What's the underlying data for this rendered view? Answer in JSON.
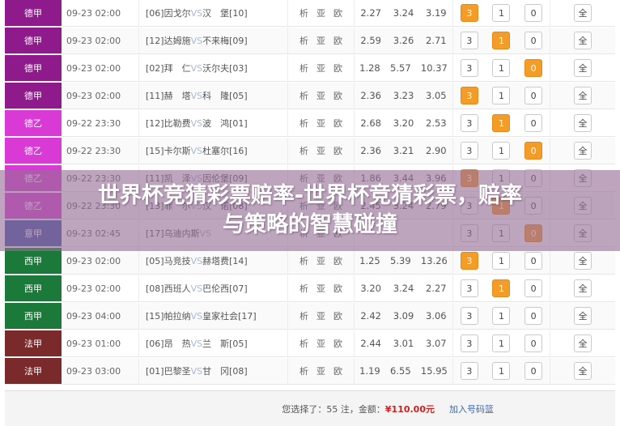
{
  "rows": [
    {
      "league": "德甲",
      "league_color": "#8e1a8c",
      "time": "09-23 02:00",
      "home": "[06]因戈尔",
      "vs": "VS",
      "away": "汉　堡[10]",
      "links": [
        "析",
        "亚",
        "欧"
      ],
      "odds": [
        "2.27",
        "3.24",
        "3.19"
      ],
      "picks": [
        "3",
        "1",
        "0"
      ],
      "selected": [
        true,
        false,
        false
      ],
      "all": "全"
    },
    {
      "league": "德甲",
      "league_color": "#8e1a8c",
      "time": "09-23 02:00",
      "home": "[12]达姆施",
      "vs": "VS",
      "away": "不来梅[09]",
      "links": [
        "析",
        "亚",
        "欧"
      ],
      "odds": [
        "2.59",
        "3.26",
        "2.71"
      ],
      "picks": [
        "3",
        "1",
        "0"
      ],
      "selected": [
        false,
        true,
        false
      ],
      "all": "全"
    },
    {
      "league": "德甲",
      "league_color": "#8e1a8c",
      "time": "09-23 02:00",
      "home": "[02]拜　仁",
      "vs": "VS",
      "away": "沃尔夫[03]",
      "links": [
        "析",
        "亚",
        "欧"
      ],
      "odds": [
        "1.28",
        "5.57",
        "10.37"
      ],
      "picks": [
        "3",
        "1",
        "0"
      ],
      "selected": [
        false,
        false,
        true
      ],
      "all": "全"
    },
    {
      "league": "德甲",
      "league_color": "#8e1a8c",
      "time": "09-23 02:00",
      "home": "[11]赫　塔",
      "vs": "VS",
      "away": "科　隆[05]",
      "links": [
        "析",
        "亚",
        "欧"
      ],
      "odds": [
        "2.36",
        "3.23",
        "3.05"
      ],
      "picks": [
        "3",
        "1",
        "0"
      ],
      "selected": [
        true,
        false,
        false
      ],
      "all": "全"
    },
    {
      "league": "德乙",
      "league_color": "#d93ad6",
      "time": "09-22 23:30",
      "home": "[12]比勒费",
      "vs": "VS",
      "away": "波　鸿[01]",
      "links": [
        "析",
        "亚",
        "欧"
      ],
      "odds": [
        "2.68",
        "3.20",
        "2.53"
      ],
      "picks": [
        "3",
        "1",
        "0"
      ],
      "selected": [
        false,
        true,
        false
      ],
      "all": "全"
    },
    {
      "league": "德乙",
      "league_color": "#d93ad6",
      "time": "09-22 23:30",
      "home": "[15]卡尔斯",
      "vs": "VS",
      "away": "杜塞尔[16]",
      "links": [
        "析",
        "亚",
        "欧"
      ],
      "odds": [
        "2.36",
        "3.21",
        "2.90"
      ],
      "picks": [
        "3",
        "1",
        "0"
      ],
      "selected": [
        false,
        false,
        true
      ],
      "all": "全"
    },
    {
      "league": "德乙",
      "league_color": "#d93ad6",
      "time": "09-22 23:30",
      "home": "[11]凯　泽",
      "vs": "VS",
      "away": "因伦堡[09]",
      "links": [
        "析",
        "亚",
        "欧"
      ],
      "odds": [
        "1.86",
        "3.44",
        "3.96"
      ],
      "picks": [
        "3",
        "1",
        "0"
      ],
      "selected": [
        true,
        false,
        false
      ],
      "all": "全"
    },
    {
      "league": "德乙",
      "league_color": "#d93ad6",
      "time": "09-22 23:30",
      "home": "[13]菲　尔",
      "vs": "VS",
      "away": "汉　诺[08]",
      "links": [
        "析",
        "亚",
        "欧"
      ],
      "odds": [
        "2.45",
        "3.24",
        "2.79"
      ],
      "picks": [
        "3",
        "1",
        "0"
      ],
      "selected": [
        false,
        true,
        false
      ],
      "all": "全"
    },
    {
      "league": "意甲",
      "league_color": "#3a52a8",
      "time": "09-23 02:45",
      "home": "[17]乌迪内斯",
      "vs": "VS",
      "away": "",
      "links": [
        "析",
        "亚",
        "欧"
      ],
      "odds": [
        "",
        "",
        ""
      ],
      "picks": [
        "3",
        "1",
        "0"
      ],
      "selected": [
        false,
        false,
        true
      ],
      "all": "全"
    },
    {
      "league": "西甲",
      "league_color": "#1b7a3a",
      "time": "09-23 02:00",
      "home": "[05]马竞技",
      "vs": "VS",
      "away": "赫塔费[14]",
      "links": [
        "析",
        "亚",
        "欧"
      ],
      "odds": [
        "1.25",
        "5.39",
        "13.26"
      ],
      "picks": [
        "3",
        "1",
        "0"
      ],
      "selected": [
        true,
        false,
        false
      ],
      "all": "全"
    },
    {
      "league": "西甲",
      "league_color": "#1b7a3a",
      "time": "09-23 02:00",
      "home": "[08]西班人",
      "vs": "VS",
      "away": "巴伦西[07]",
      "links": [
        "析",
        "亚",
        "欧"
      ],
      "odds": [
        "3.20",
        "3.24",
        "2.27"
      ],
      "picks": [
        "3",
        "1",
        "0"
      ],
      "selected": [
        false,
        true,
        false
      ],
      "all": "全"
    },
    {
      "league": "西甲",
      "league_color": "#1b7a3a",
      "time": "09-23 04:00",
      "home": "[15]帕拉纳",
      "vs": "VS",
      "away": "皇家社会[17]",
      "links": [
        "析",
        "亚",
        "欧"
      ],
      "odds": [
        "2.42",
        "3.09",
        "3.06"
      ],
      "picks": [
        "3",
        "1",
        "0"
      ],
      "selected": [
        false,
        false,
        false
      ],
      "all": "全"
    },
    {
      "league": "法甲",
      "league_color": "#7a2a2a",
      "time": "09-23 01:00",
      "home": "[06]昂　热",
      "vs": "VS",
      "away": "兰　斯[05]",
      "links": [
        "析",
        "亚",
        "欧"
      ],
      "odds": [
        "2.44",
        "3.01",
        "3.07"
      ],
      "picks": [
        "3",
        "1",
        "0"
      ],
      "selected": [
        false,
        false,
        false
      ],
      "all": "全"
    },
    {
      "league": "法甲",
      "league_color": "#7a2a2a",
      "time": "09-23 03:00",
      "home": "[01]巴黎圣",
      "vs": "VS",
      "away": "甘　冈[08]",
      "links": [
        "析",
        "亚",
        "欧"
      ],
      "odds": [
        "1.19",
        "6.55",
        "15.95"
      ],
      "picks": [
        "3",
        "1",
        "0"
      ],
      "selected": [
        false,
        false,
        false
      ],
      "all": "全"
    }
  ],
  "footer": {
    "selected_text": "您选择了：55 注，金额：",
    "amount": "¥110.00元",
    "add_label": "加入号码篮"
  },
  "banner": {
    "line1": "世界杯竞猜彩票赔率-世界杯竞猜彩票，赔率",
    "line2": "与策略的智慧碰撞"
  }
}
